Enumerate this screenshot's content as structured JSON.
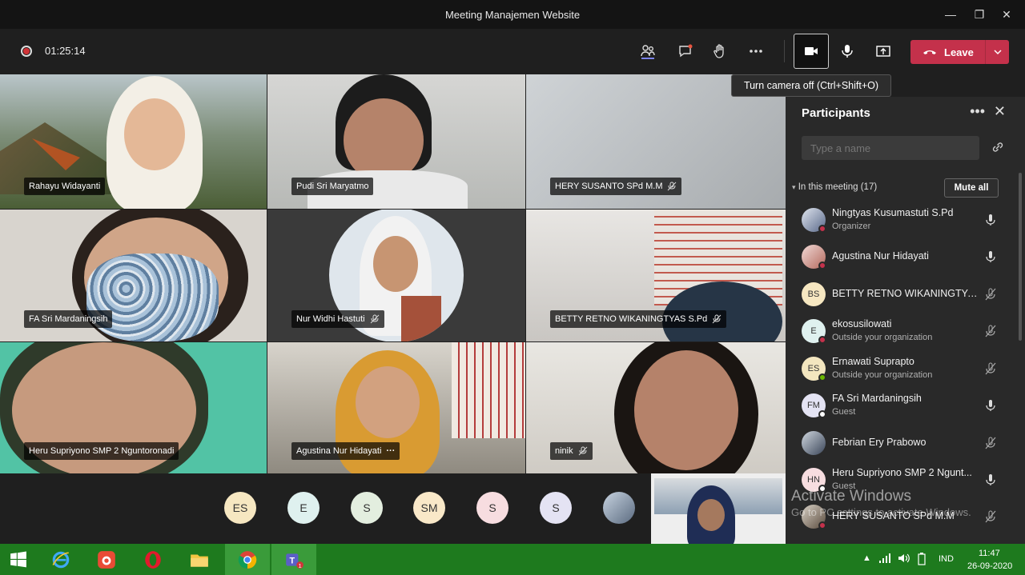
{
  "window": {
    "title": "Meeting Manajemen Website"
  },
  "toolbar": {
    "timer": "01:25:14",
    "leave_label": "Leave",
    "camera_tooltip": "Turn camera off (Ctrl+Shift+O)"
  },
  "tiles": [
    {
      "name": "Rahayu Widayanti",
      "muted": false
    },
    {
      "name": "Pudi Sri Maryatmo",
      "muted": false
    },
    {
      "name": "HERY SUSANTO SPd M.M",
      "muted": true
    },
    {
      "name": "FA Sri Mardaningsih",
      "muted": false
    },
    {
      "name": "Nur Widhi Hastuti",
      "muted": true
    },
    {
      "name": "BETTY RETNO WIKANINGTYAS S.Pd",
      "muted": true
    },
    {
      "name": "Heru Supriyono SMP 2 Nguntoronadi",
      "muted": false
    },
    {
      "name": "Agustina Nur Hidayati",
      "muted": false,
      "more": "···"
    },
    {
      "name": "ninik",
      "muted": true
    }
  ],
  "strip_avatars": [
    "ES",
    "E",
    "S",
    "SM",
    "S",
    "S"
  ],
  "panel": {
    "title": "Participants",
    "search_placeholder": "Type a name",
    "in_meeting": "In this meeting (17)",
    "mute_all": "Mute all",
    "participants": [
      {
        "name": "Ningtyas Kusumastuti S.Pd",
        "sub": "Organizer",
        "initials": "",
        "mic": "on"
      },
      {
        "name": "Agustina Nur Hidayati",
        "sub": "",
        "initials": "",
        "mic": "on"
      },
      {
        "name": "BETTY RETNO WIKANINGTYA...",
        "sub": "",
        "initials": "BS",
        "mic": "off"
      },
      {
        "name": "ekosusilowati",
        "sub": "Outside your organization",
        "initials": "E",
        "mic": "off"
      },
      {
        "name": "Ernawati Suprapto",
        "sub": "Outside your organization",
        "initials": "ES",
        "mic": "off"
      },
      {
        "name": "FA Sri Mardaningsih",
        "sub": "Guest",
        "initials": "FM",
        "mic": "on"
      },
      {
        "name": "Febrian Ery Prabowo",
        "sub": "",
        "initials": "",
        "mic": "off"
      },
      {
        "name": "Heru Supriyono SMP 2 Ngunt...",
        "sub": "Guest",
        "initials": "HN",
        "mic": "on"
      },
      {
        "name": "HERY SUSANTO SPd M.M",
        "sub": "",
        "initials": "",
        "mic": "off"
      }
    ]
  },
  "watermark": {
    "line1": "Activate Windows",
    "line2": "Go to PC settings to activate Windows."
  },
  "tray": {
    "lang": "IND",
    "time": "11:47",
    "date": "26-09-2020"
  }
}
